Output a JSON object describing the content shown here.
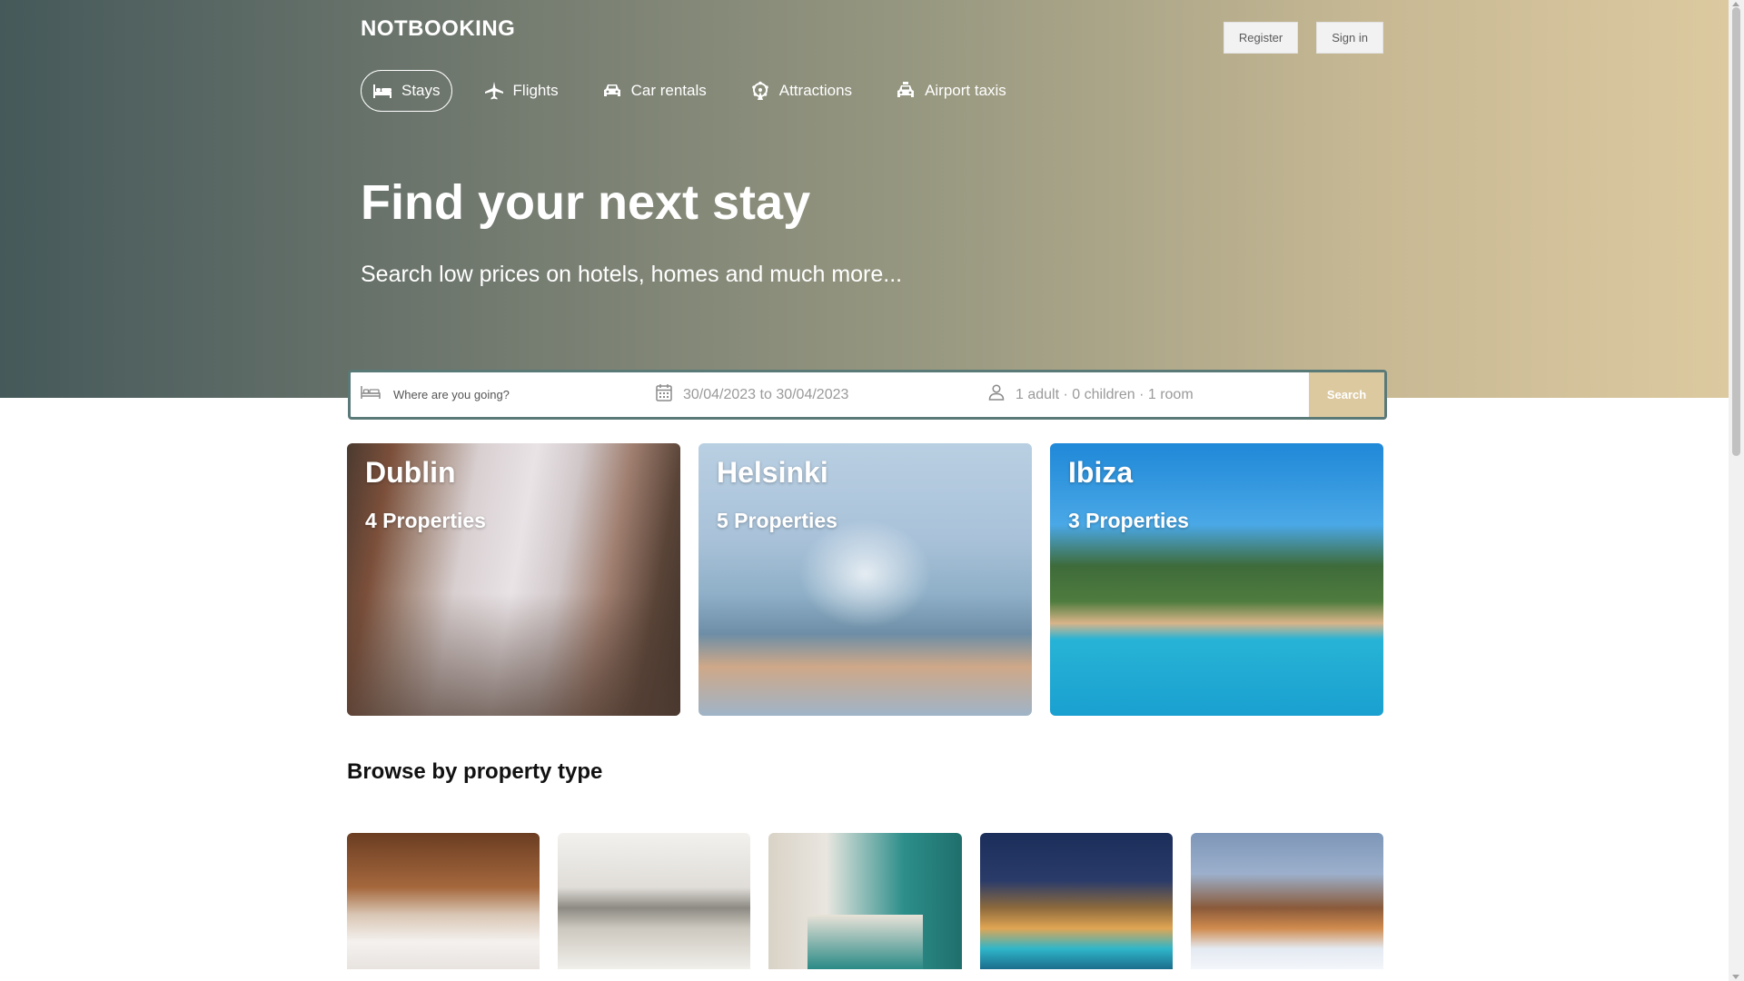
{
  "header": {
    "logo": "NOTBOOKING",
    "register_label": "Register",
    "signin_label": "Sign in"
  },
  "nav": {
    "items": [
      {
        "label": "Stays",
        "icon": "bed-icon",
        "active": true
      },
      {
        "label": "Flights",
        "icon": "plane-icon",
        "active": false
      },
      {
        "label": "Car rentals",
        "icon": "car-icon",
        "active": false
      },
      {
        "label": "Attractions",
        "icon": "ferris-wheel-icon",
        "active": false
      },
      {
        "label": "Airport taxis",
        "icon": "taxi-icon",
        "active": false
      }
    ]
  },
  "hero": {
    "title": "Find your next stay",
    "subtitle": "Search low prices on hotels, homes and much more..."
  },
  "search": {
    "destination_placeholder": "Where are you going?",
    "dates": "30/04/2023 to 30/04/2023",
    "guests": "1 adult · 0 children · 1 room",
    "button_label": "Search"
  },
  "cities": [
    {
      "name": "Dublin",
      "count": "4 Properties"
    },
    {
      "name": "Helsinki",
      "count": "5 Properties"
    },
    {
      "name": "Ibiza",
      "count": "3 Properties"
    }
  ],
  "property_types": {
    "title": "Browse by property type"
  },
  "colors": {
    "accent": "#dcc9a0",
    "search_border": "#5a7a78"
  }
}
